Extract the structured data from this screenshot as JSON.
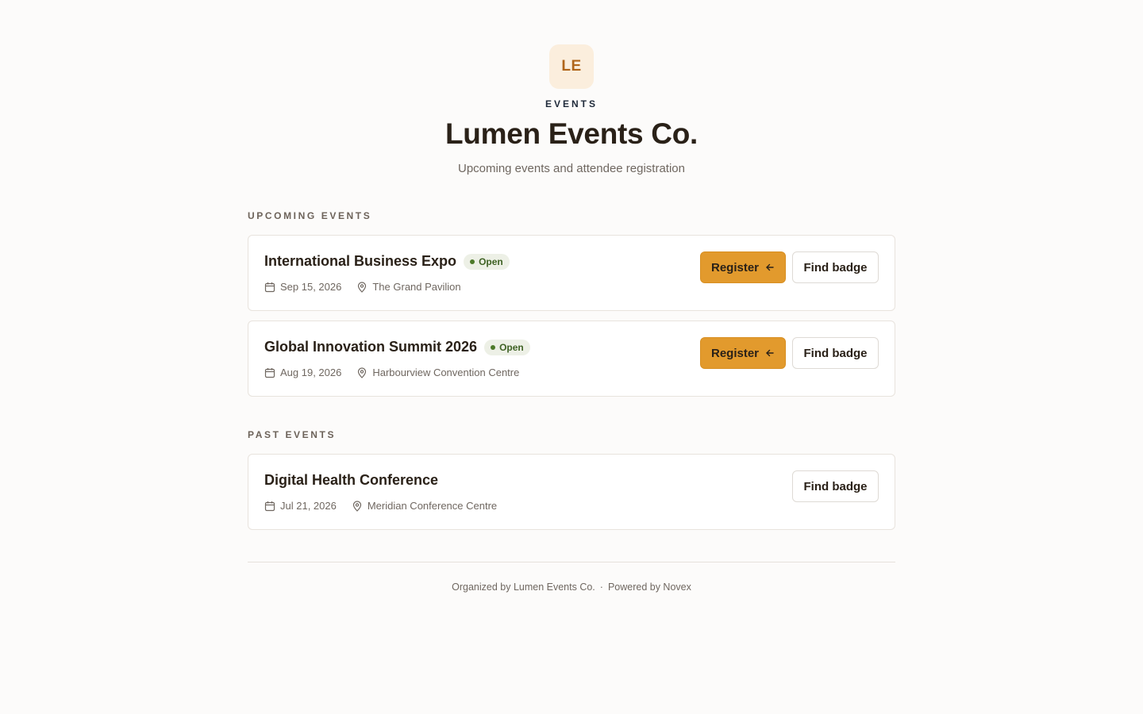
{
  "header": {
    "logo_initials": "LE",
    "eyebrow": "EVENTS",
    "title": "Lumen Events Co.",
    "subtitle": "Upcoming events and attendee registration"
  },
  "sections": {
    "upcoming_label": "UPCOMING EVENTS",
    "past_label": "PAST EVENTS"
  },
  "upcoming_events": [
    {
      "title": "International Business Expo",
      "status": "Open",
      "date": "Sep 15, 2026",
      "venue": "The Grand Pavilion",
      "register_label": "Register",
      "badge_label": "Find badge"
    },
    {
      "title": "Global Innovation Summit 2026",
      "status": "Open",
      "date": "Aug 19, 2026",
      "venue": "Harbourview Convention Centre",
      "register_label": "Register",
      "badge_label": "Find badge"
    }
  ],
  "past_events": [
    {
      "title": "Digital Health Conference",
      "date": "Jul 21, 2026",
      "venue": "Meridian Conference Centre",
      "badge_label": "Find badge"
    }
  ],
  "footer": {
    "organizer": "Organized by Lumen Events Co.",
    "separator": "·",
    "powered_by": "Powered by Novex"
  },
  "colors": {
    "accent": "#e29a2d",
    "status_open": "#4d7a2a",
    "logo_bg": "#fbeedd"
  },
  "icons": {
    "date": "calendar-icon",
    "venue": "map-pin-icon",
    "register": "arrow-left-icon"
  }
}
